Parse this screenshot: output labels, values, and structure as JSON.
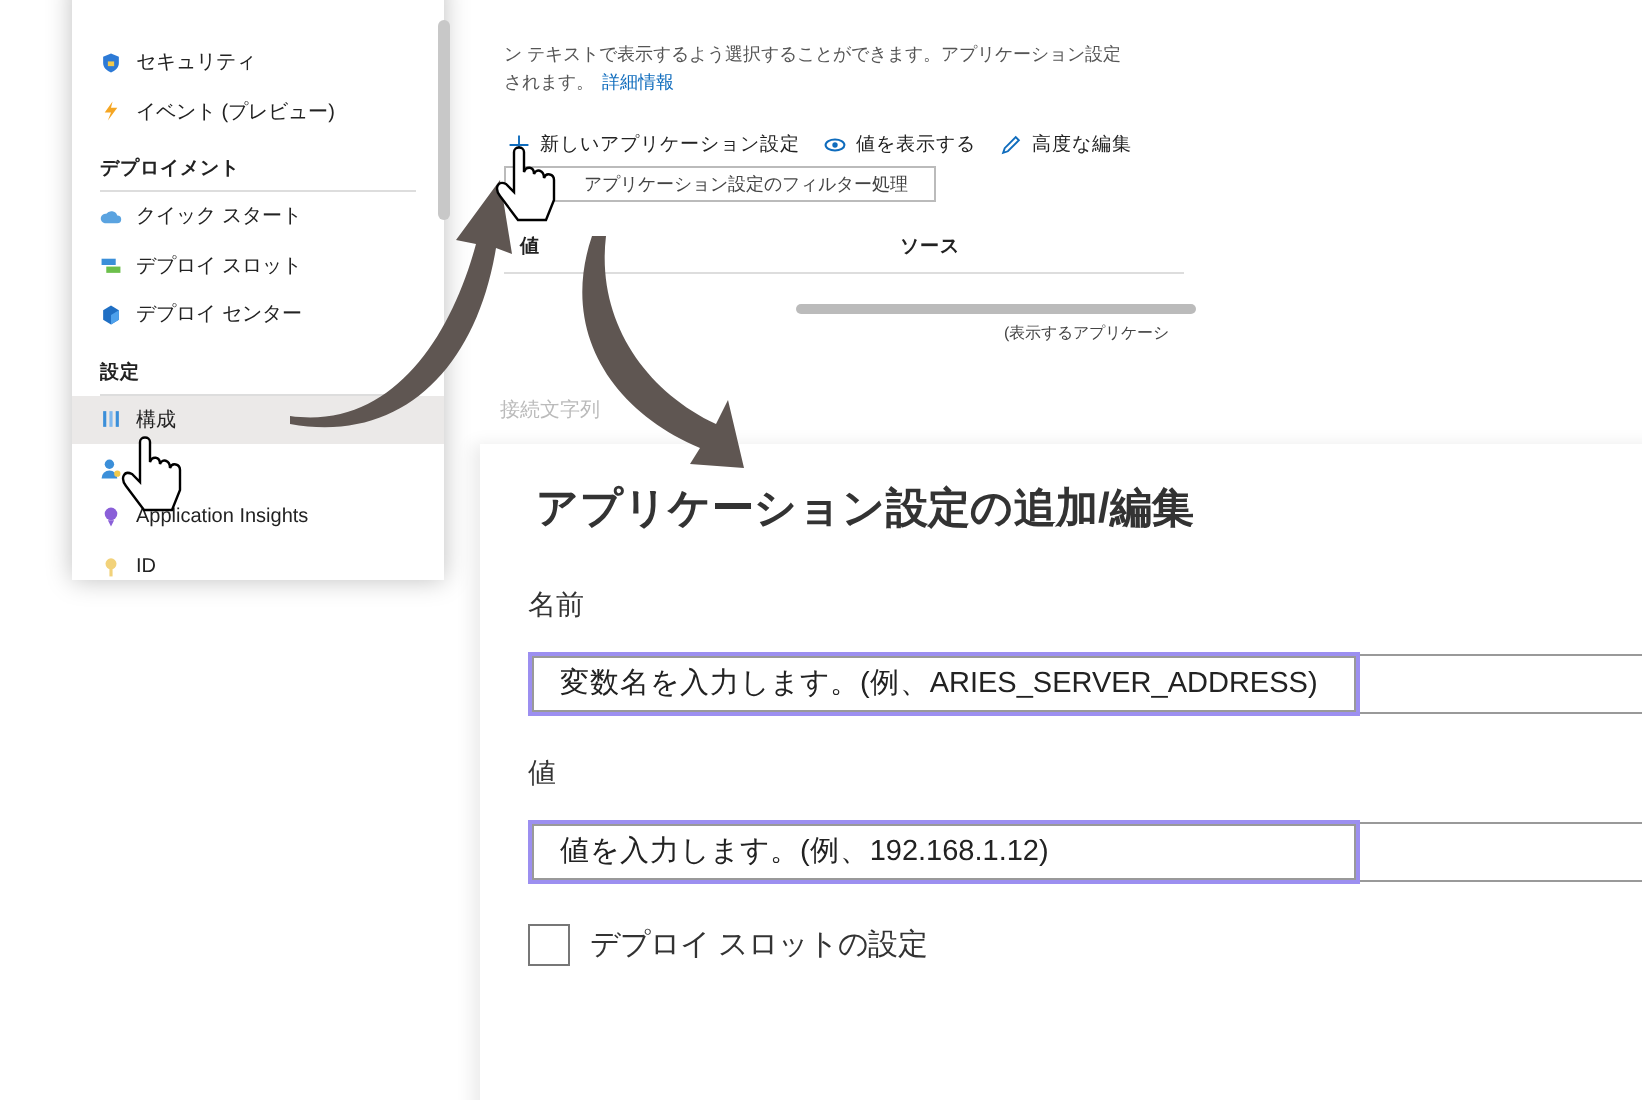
{
  "sidebar": {
    "sections": [
      {
        "items": [
          {
            "label": "セキュリティ",
            "selected": false
          },
          {
            "label": "イベント (プレビュー)",
            "selected": false
          }
        ]
      },
      {
        "heading": "デプロイメント",
        "items": [
          {
            "label": "クイック スタート",
            "selected": false
          },
          {
            "label": "デプロイ スロット",
            "selected": false
          },
          {
            "label": "デプロイ センター",
            "selected": false
          }
        ]
      },
      {
        "heading": "設定",
        "items": [
          {
            "label": "構成",
            "selected": true
          },
          {
            "selected": false
          },
          {
            "label": "Application Insights",
            "selected": false
          },
          {
            "label": "ID",
            "selected": false
          }
        ]
      }
    ]
  },
  "settings_panel": {
    "description_lines": [
      "ン テキストで表示するよう選択することができます。アプリケーション設定"
    ],
    "description_end": "されます。",
    "learn_more_link": "詳細情報",
    "toolbar": [
      {
        "label": "新しいアプリケーション設定"
      },
      {
        "label": "値を表示する"
      },
      {
        "label": "高度な編集"
      }
    ],
    "filter": {
      "placeholder": "アプリケーション設定のフィルター処理"
    },
    "table": {
      "columns": [
        "値",
        "ソース"
      ]
    },
    "footer_note": "(表示するアプリケーシ",
    "next_section": "接続文字列"
  },
  "dialog": {
    "title": "アプリケーション設定の追加/編集",
    "fields": [
      {
        "label": "名前",
        "placeholder": "変数名を入力します。(例、ARIES_SERVER_ADDRESS)"
      },
      {
        "label": "値",
        "placeholder": "値を入力します。(例、192.168.1.12)"
      }
    ],
    "checkbox": {
      "label": "デプロイ スロットの設定",
      "checked": false
    }
  }
}
